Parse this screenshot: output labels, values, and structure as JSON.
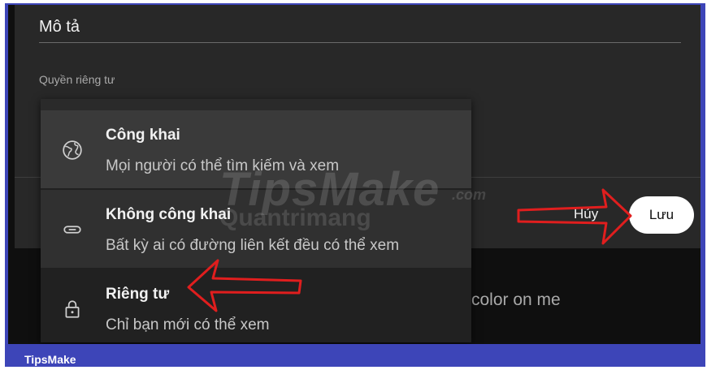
{
  "dialog": {
    "description_label": "Mô tả",
    "privacy_label": "Quyền riêng tư",
    "cancel_label": "Hủy",
    "save_label": "Lưu"
  },
  "privacy_menu": {
    "items": [
      {
        "title": "Công khai",
        "subtitle": "Mọi người có thể tìm kiếm và xem",
        "icon": "globe-icon"
      },
      {
        "title": "Không công khai",
        "subtitle": "Bất kỳ ai có đường liên kết đều có thể xem",
        "icon": "link-icon"
      },
      {
        "title": "Riêng tư",
        "subtitle": "Chỉ bạn mới có thể xem",
        "icon": "lock-icon"
      }
    ]
  },
  "background": {
    "partial_text": "color on me"
  },
  "watermark": {
    "brand": "TipsMake",
    "domain": ".com",
    "sub_brand": "Quantrimang"
  },
  "footer": {
    "brand": "TipsMake"
  },
  "colors": {
    "frame": "#3d45b8",
    "dialog_bg": "#282828",
    "menu_bg": "#212121",
    "annotation_arrow": "#e01e1e",
    "save_button_bg": "#ffffff"
  }
}
